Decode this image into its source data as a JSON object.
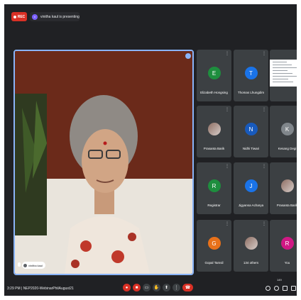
{
  "top_bar": {
    "rec_label": "REC",
    "presenting_initial": "v",
    "presenting_text": "vinitha kaul is presenting"
  },
  "main_speaker": {
    "name": "vinitha kaul"
  },
  "participants": [
    {
      "name": "Elizabeth Hongsing",
      "initial": "E",
      "color": "#1e8e3e"
    },
    {
      "name": "Thomas Lhungdim",
      "initial": "T",
      "color": "#1a73e8"
    },
    {
      "name": "",
      "initial": "",
      "color": "#ffffff",
      "shared_doc": true
    },
    {
      "name": "Prasanta Barik",
      "initial": "",
      "color": "#5f6368",
      "photo": true
    },
    {
      "name": "Nidhi Tiwari",
      "initial": "N",
      "color": "#185abc"
    },
    {
      "name": "Kesang Degi",
      "initial": "K",
      "color": "#80868b"
    },
    {
      "name": "Registrar",
      "initial": "R",
      "color": "#1e8e3e"
    },
    {
      "name": "Jigyansa Acharya",
      "initial": "J",
      "color": "#1a73e8"
    },
    {
      "name": "Prasanta Barik",
      "initial": "",
      "color": "#5f6368",
      "photo": true
    },
    {
      "name": "Gopal Tamsil",
      "initial": "G",
      "color": "#e8711a"
    },
    {
      "name": "134 others",
      "initial": "",
      "color": "#5f6368",
      "photo": true
    },
    {
      "name": "You",
      "initial": "R",
      "color": "#d01884"
    }
  ],
  "bottom_bar": {
    "time_meeting": "3:29 PM | NEP2020-WebinarPhilAugust21",
    "participant_count": "149"
  },
  "colors": {
    "background": "#202124",
    "tile": "#3c4043",
    "accent": "#8ab4f8",
    "danger": "#d93025"
  }
}
